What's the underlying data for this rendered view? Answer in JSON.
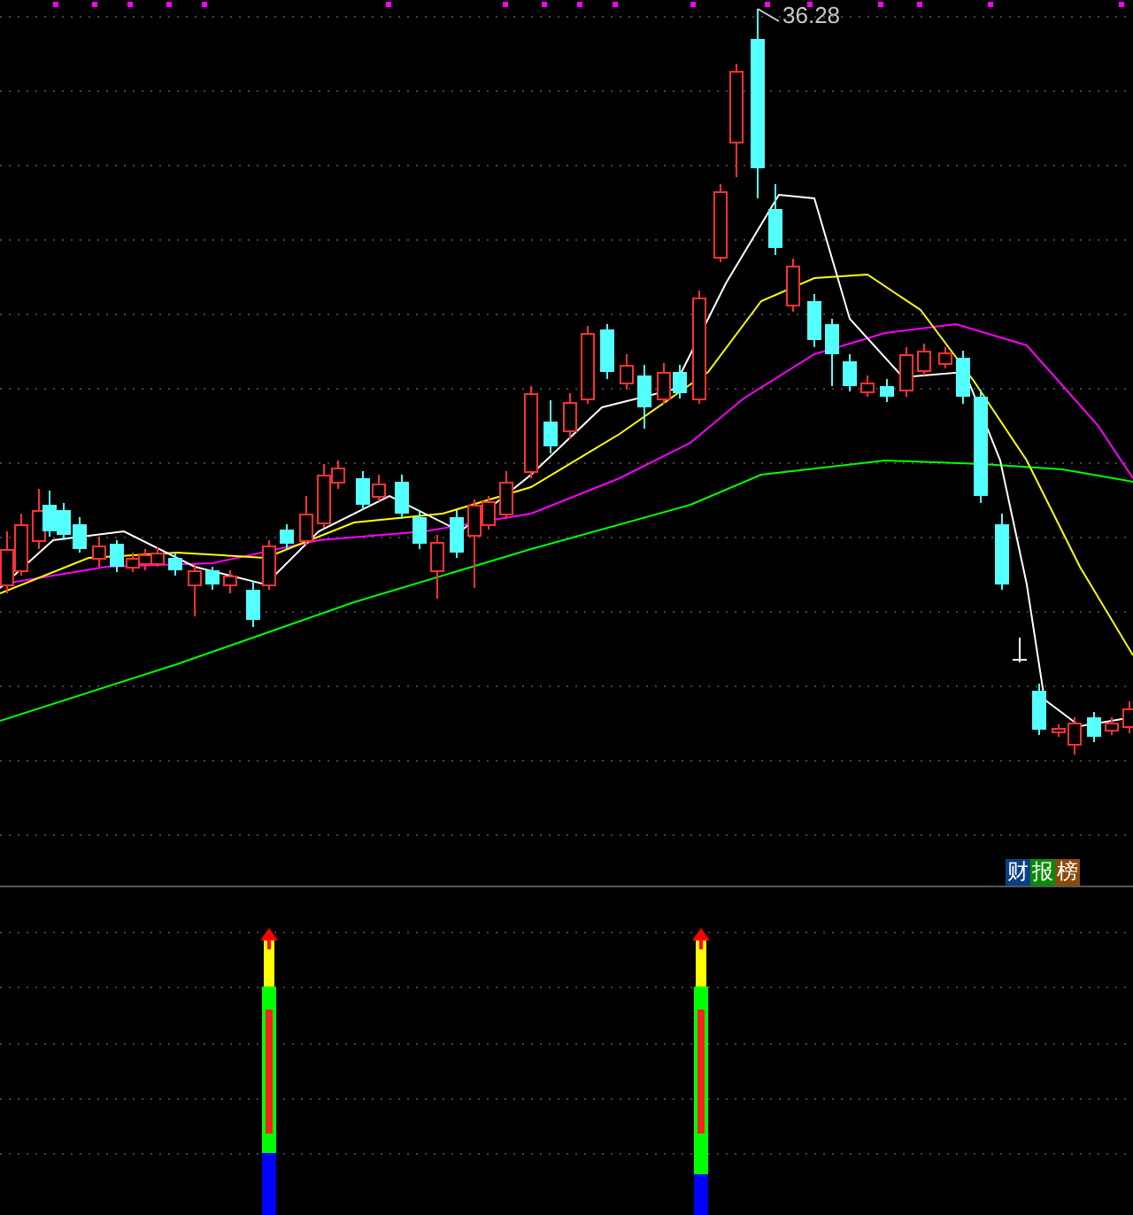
{
  "main_chart": {
    "high_label": "36.28"
  },
  "badge": {
    "chars": [
      {
        "text": "财",
        "color": "#0b3f86"
      },
      {
        "text": "报",
        "color": "#0a8a0a"
      },
      {
        "text": "榜",
        "color": "#8a4a0a"
      }
    ]
  }
}
